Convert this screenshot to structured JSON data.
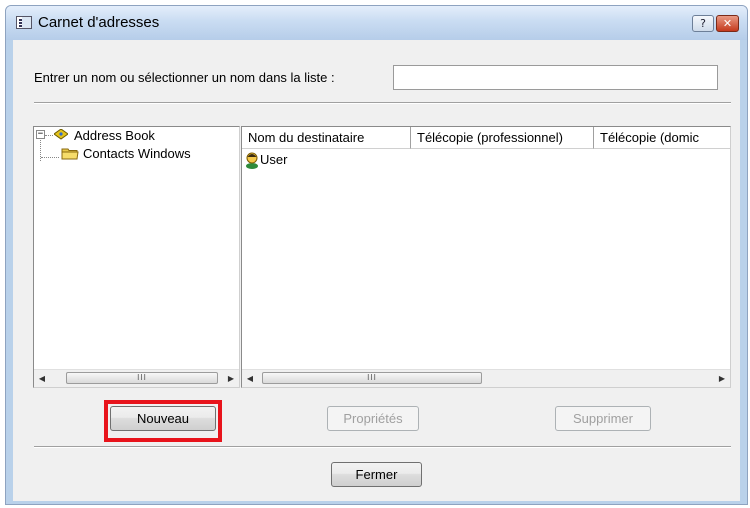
{
  "window": {
    "title": "Carnet d'adresses",
    "help_glyph": "?",
    "close_glyph": "✕"
  },
  "search": {
    "label": "Entrer un nom ou sélectionner un nom dans la liste :",
    "value": ""
  },
  "tree": {
    "expander": "−",
    "root": "Address Book",
    "child": "Contacts Windows"
  },
  "list": {
    "columns": [
      "Nom du destinataire",
      "Télécopie (professionnel)",
      "Télécopie (domic"
    ],
    "rows": [
      {
        "name": "User"
      }
    ]
  },
  "scrollbars": {
    "left_arrow": "◀",
    "right_arrow": "▶",
    "grip": "III"
  },
  "buttons": {
    "new": "Nouveau",
    "properties": "Propriétés",
    "delete": "Supprimer",
    "close": "Fermer"
  },
  "colors": {
    "highlight": "#e8131b",
    "title_bg": "#c9dcf2"
  }
}
